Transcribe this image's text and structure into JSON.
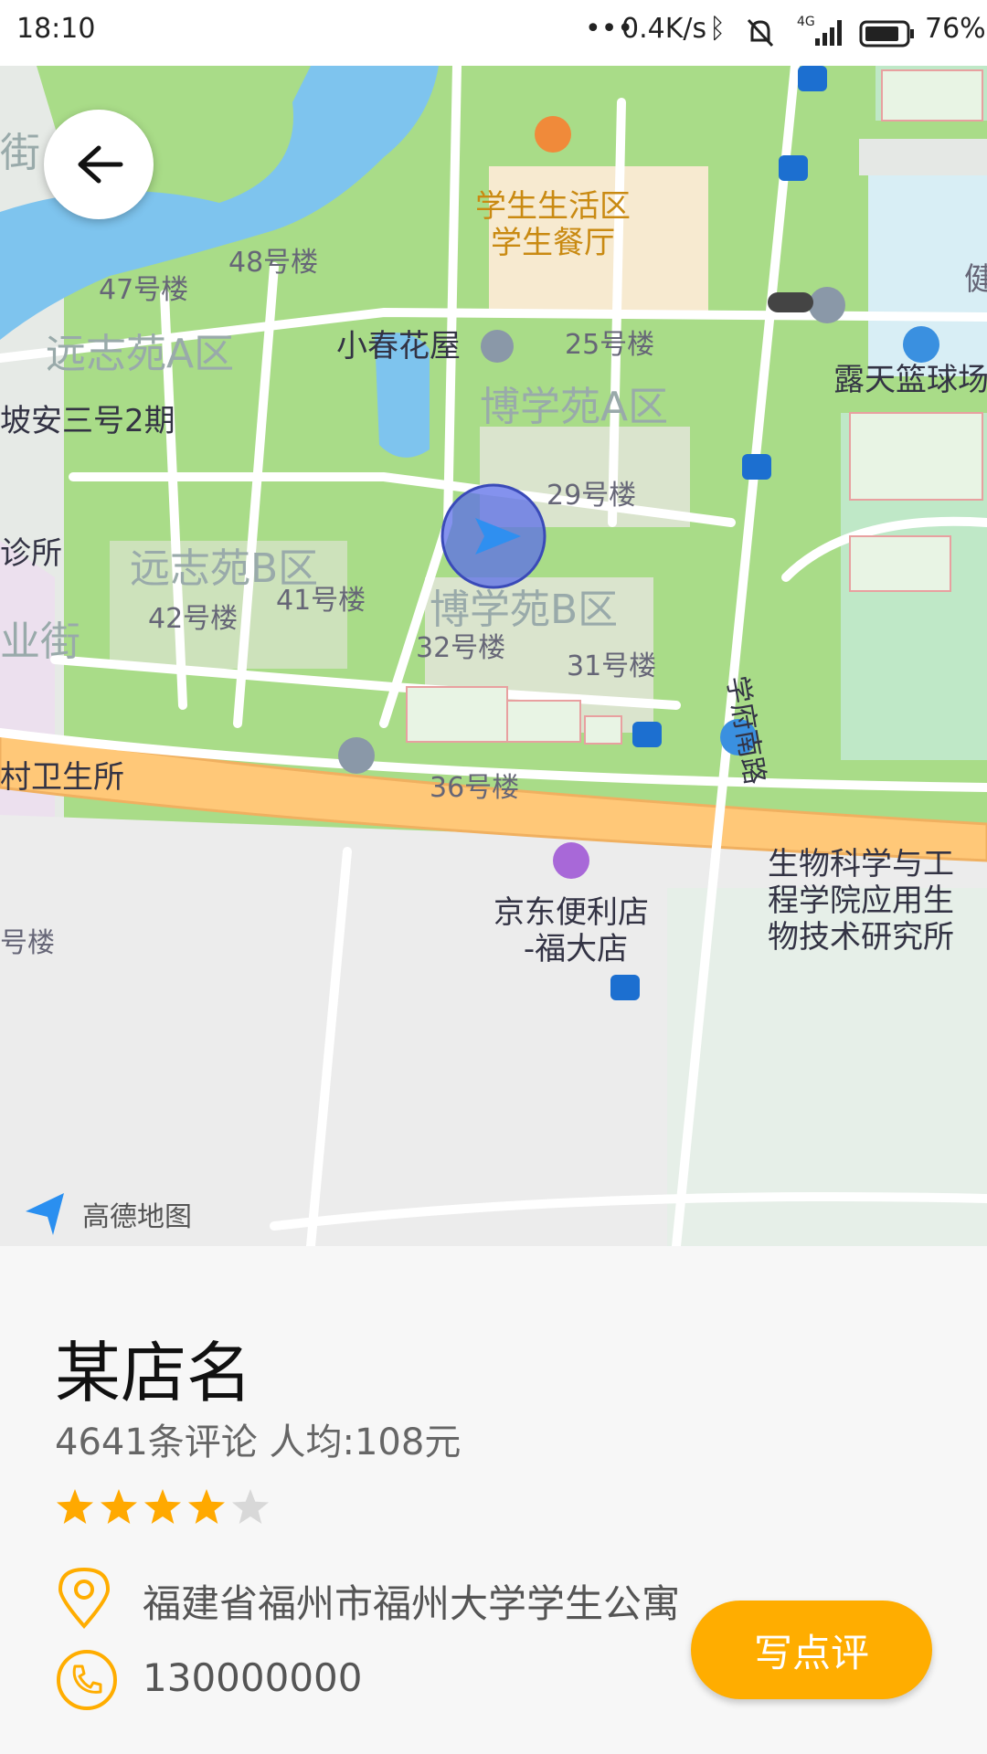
{
  "status_bar": {
    "time": "18:10",
    "net_speed": "0.4K/s",
    "network": "4G",
    "battery": "76%"
  },
  "map": {
    "brand": "高德地图",
    "labels": {
      "canteen1": "学生生活区",
      "canteen2": "学生餐厅",
      "b48": "48号楼",
      "b47": "47号楼",
      "b25": "25号楼",
      "b29": "29号楼",
      "b42": "42号楼",
      "b41": "41号楼",
      "b32": "32号楼",
      "b31": "31号楼",
      "b36": "36号楼",
      "yza": "远志苑A区",
      "yzb": "远志苑B区",
      "bxa": "博学苑A区",
      "bxb": "博学苑B区",
      "flower": "小春花屋",
      "court": "露天篮球场",
      "road": "学府南路",
      "bio1": "生物科学与工",
      "bio2": "程学院应用生",
      "bio3": "物技术研究所",
      "jd1": "京东便利店",
      "jd2": "-福大店",
      "clinic": "村卫生所",
      "left1": "坡安三号2期",
      "left2": "诊所",
      "left3": "业街",
      "left4": "街",
      "left5": "号楼",
      "right1": "健"
    }
  },
  "shop": {
    "name": "某店名",
    "reviews": "4641条评论 人均:108元",
    "rating": 4,
    "rating_max": 5,
    "address": "福建省福州市福州大学学生公寓",
    "phone": "130000000",
    "write_review": "写点评"
  },
  "colors": {
    "accent": "#ffad00",
    "star": "#ffa900",
    "star_empty": "#d8d8d8",
    "map_green": "#a9dc88",
    "road_orange": "#ffc878"
  }
}
